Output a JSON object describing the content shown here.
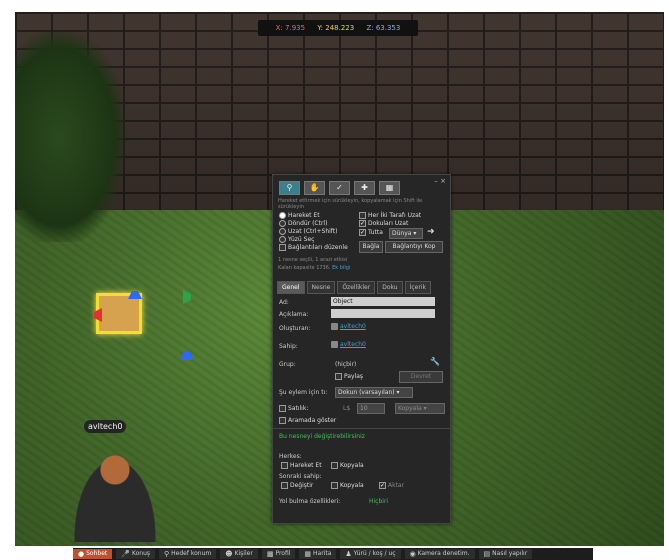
{
  "coords": {
    "x": "X: 7.935",
    "y": "Y: 248.223",
    "z": "Z: 63.353"
  },
  "avatar_name": "avltech0",
  "build": {
    "hint": "Hareket ettirmek için sürükleyin, kopyalamak için Shift ile sürükleyin",
    "modes_left": [
      "Hareket Et",
      "Döndür (Ctrl)",
      "Uzat (Ctrl+Shift)",
      "Yüzü Seç",
      "Bağlantıları düzenle"
    ],
    "modes_right": [
      "Her İki Tarafı Uzat",
      "Dokuları Uzat",
      "Tutta"
    ],
    "grid_select": "Dünya",
    "link_btn": "Bağla",
    "unlink_btn": "Bağlantıyı Kop",
    "info_line1": "1 nesne seçili, 1 arazi etkisi",
    "info_line2": "Kalan kapasite 1736.",
    "info_link": "Ek bilgi",
    "tabs": [
      "Genel",
      "Nesne",
      "Özellikler",
      "Doku",
      "İçerik"
    ],
    "name_label": "Ad:",
    "name_value": "Object",
    "desc_label": "Açıklama:",
    "creator_label": "Oluşturan:",
    "creator": "avltech0",
    "owner_label": "Sahip:",
    "owner": "avltech0",
    "group_label": "Grup:",
    "group_value": "(hiçbir)",
    "share_label": "Paylaş",
    "deed_btn": "Devret",
    "click_action_label": "Şu eylem için tı:",
    "click_action_value": "Dokun (varsayılan)",
    "for_sale_label": "Satılık:",
    "price": "L$",
    "price_value": "10",
    "copy_select": "Kopyala",
    "show_search_label": "Aramada göster",
    "modify_notice": "Bu nesneyi değiştirebilirsiniz",
    "everyone_label": "Herkes:",
    "everyone_move": "Hareket Et",
    "everyone_copy": "Kopyala",
    "next_owner_label": "Sonraki sahip:",
    "next_modify": "Değiştir",
    "next_copy": "Kopyala",
    "next_transfer": "Aktar",
    "pathfinding_label": "Yol bulma özellikleri:",
    "pathfinding_value": "Hiçbiri"
  },
  "bottombar": [
    {
      "label": "Sohbet",
      "icon": "chat-icon"
    },
    {
      "label": "Konuş",
      "icon": "speak-icon"
    },
    {
      "label": "Hedef konum",
      "icon": "destination-icon"
    },
    {
      "label": "Kişiler",
      "icon": "people-icon"
    },
    {
      "label": "Profil",
      "icon": "profile-icon"
    },
    {
      "label": "Harita",
      "icon": "map-icon"
    },
    {
      "label": "Yürü / koş / uç",
      "icon": "walk-icon"
    },
    {
      "label": "Kamera denetim.",
      "icon": "camera-icon"
    },
    {
      "label": "Nasıl yapılır",
      "icon": "howto-icon"
    }
  ]
}
